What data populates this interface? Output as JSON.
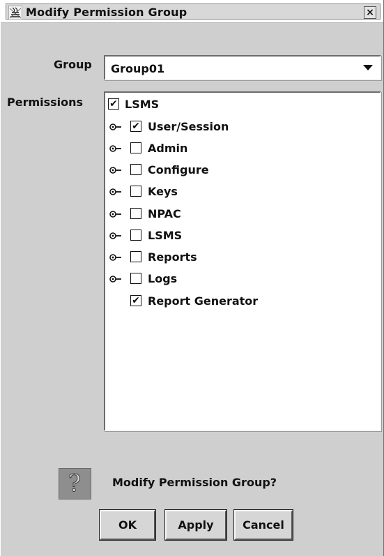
{
  "window": {
    "title": "Modify Permission Group",
    "icon": "java-coffee-cup-icon",
    "close_label": "×"
  },
  "form": {
    "group_label": "Group",
    "group_value": "Group01",
    "permissions_label": "Permissions"
  },
  "tree": {
    "root": {
      "label": "LSMS",
      "checked": true,
      "mark": "✔"
    },
    "children": [
      {
        "label": "User/Session",
        "checked": true,
        "mark": "✔",
        "expandable": true
      },
      {
        "label": "Admin",
        "checked": false,
        "mark": "",
        "expandable": true
      },
      {
        "label": "Configure",
        "checked": false,
        "mark": "",
        "expandable": true
      },
      {
        "label": "Keys",
        "checked": false,
        "mark": "",
        "expandable": true
      },
      {
        "label": "NPAC",
        "checked": false,
        "mark": "",
        "expandable": true
      },
      {
        "label": "LSMS",
        "checked": false,
        "mark": "",
        "expandable": true
      },
      {
        "label": "Reports",
        "checked": false,
        "mark": "",
        "expandable": true
      },
      {
        "label": "Logs",
        "checked": false,
        "mark": "",
        "expandable": true
      },
      {
        "label": "Report Generator",
        "checked": true,
        "mark": "✔",
        "expandable": false
      }
    ]
  },
  "footer": {
    "prompt": "Modify Permission Group?",
    "help_icon": "question-mark-icon",
    "ok_label": "OK",
    "apply_label": "Apply",
    "cancel_label": "Cancel"
  }
}
